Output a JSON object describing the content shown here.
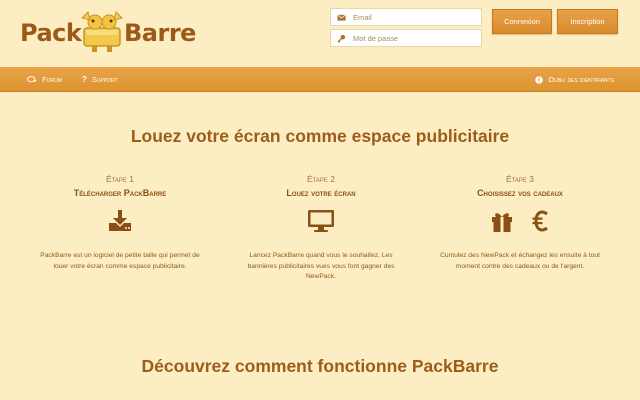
{
  "brand": {
    "word1": "Pack",
    "word2": "Barre"
  },
  "login": {
    "email_placeholder": "Email",
    "password_placeholder": "Mot de passe",
    "login_label": "Connexion",
    "signup_label": "Inscription"
  },
  "nav": {
    "forum": "Forum",
    "support": "Support",
    "forgot": "Oubli des identifiants"
  },
  "hero": {
    "title": "Louez votre écran comme espace publicitaire"
  },
  "steps": [
    {
      "label": "Étape 1",
      "title": "Télécharger PackBarre",
      "icons": [
        "download-icon"
      ],
      "description": "PackBarre est un logiciel de petite taille qui permet de louer votre écran comme espace publicitaire."
    },
    {
      "label": "Étape 2",
      "title": "Louez votre écran",
      "icons": [
        "monitor-icon"
      ],
      "description": "Lancez PackBarre quand vous le souhaitez. Les bannières publicitaires vues vous font gagner des NewPack."
    },
    {
      "label": "Étape 3",
      "title": "Choisissez vos cadeaux",
      "icons": [
        "gift-icon",
        "euro-icon"
      ],
      "description": "Cumulez des NewPack et échangez les ensuite à tout moment contre des cadeaux ou de l'argent."
    }
  ],
  "section2": {
    "title": "Découvrez comment fonctionne PackBarre"
  },
  "colors": {
    "background": "#fdedc3",
    "accent": "#e09a3c",
    "brown": "#8a4f14"
  }
}
